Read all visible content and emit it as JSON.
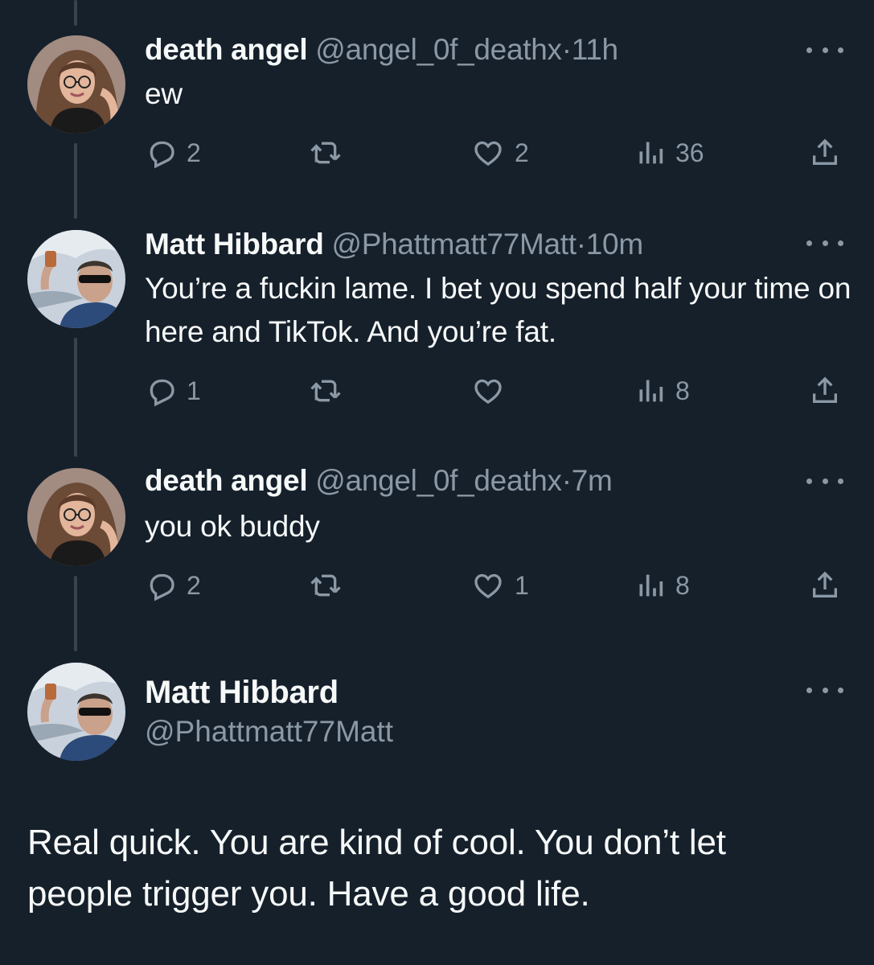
{
  "thread": [
    {
      "author": "death angel",
      "handle": "@angel_0f_deathx",
      "separator": "·",
      "time": "11h",
      "text": "ew",
      "replies": "2",
      "retweets": "",
      "likes": "2",
      "views": "36",
      "avatar": "woman-with-glasses"
    },
    {
      "author": "Matt Hibbard",
      "handle": "@Phattmatt77Matt",
      "separator": "·",
      "time": "10m",
      "text": "You’re a fuckin lame. I bet you spend half your time on here and TikTok. And you’re fat.",
      "replies": "1",
      "retweets": "",
      "likes": "",
      "views": "8",
      "avatar": "man-with-sunglasses"
    },
    {
      "author": "death angel",
      "handle": "@angel_0f_deathx",
      "separator": "·",
      "time": "7m",
      "text": "you ok buddy",
      "replies": "2",
      "retweets": "",
      "likes": "1",
      "views": "8",
      "avatar": "woman-with-glasses"
    }
  ],
  "main_tweet": {
    "author": "Matt Hibbard",
    "handle": "@Phattmatt77Matt",
    "text": "Real quick. You are kind of cool. You don’t let people trigger you. Have a good life.",
    "avatar": "man-with-sunglasses"
  },
  "icons": {
    "reply": "reply-icon",
    "retweet": "retweet-icon",
    "like": "like-icon",
    "views": "views-icon",
    "share": "share-icon",
    "more": "more-icon"
  },
  "colors": {
    "background": "#15202b",
    "text": "#f7f9f9",
    "secondary": "#8b98a5",
    "thread_line": "#38444d"
  }
}
